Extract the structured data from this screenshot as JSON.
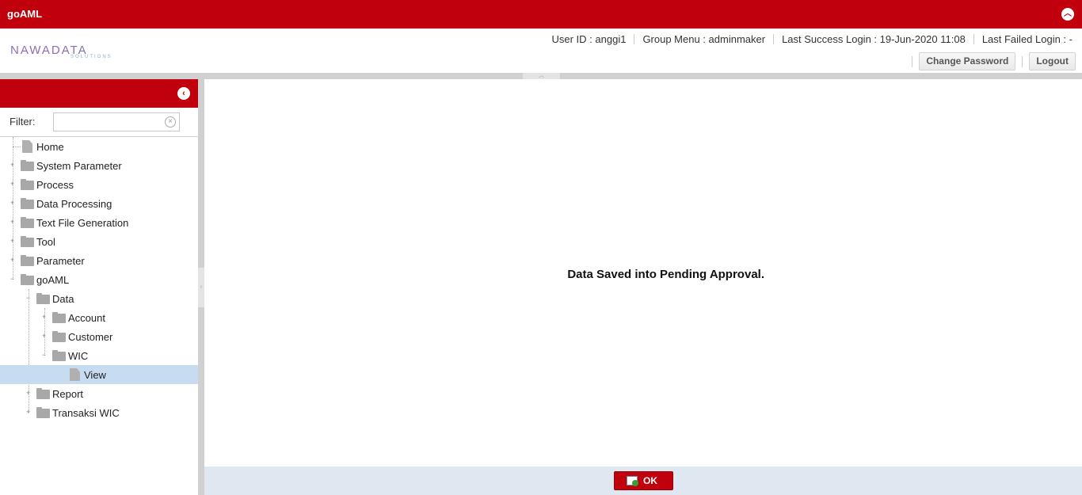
{
  "app": {
    "title": "goAML"
  },
  "header": {
    "logo_text": "NAWADATA",
    "logo_sub": "SOLUTIONS",
    "user_id": "User ID : anggi1",
    "group_menu": "Group Menu : adminmaker",
    "last_success_login": "Last Success Login : 19-Jun-2020 11:08",
    "last_failed_login": "Last Failed Login : -",
    "change_password_label": "Change Password",
    "logout_label": "Logout"
  },
  "sidebar": {
    "filter_label": "Filter:",
    "filter_value": "",
    "tree": [
      {
        "label": "Home",
        "type": "doc"
      },
      {
        "label": "System Parameter",
        "type": "folder"
      },
      {
        "label": "Process",
        "type": "folder"
      },
      {
        "label": "Data Processing",
        "type": "folder"
      },
      {
        "label": "Text File Generation",
        "type": "folder"
      },
      {
        "label": "Tool",
        "type": "folder"
      },
      {
        "label": "Parameter",
        "type": "folder"
      },
      {
        "label": "goAML",
        "type": "folder-open"
      },
      {
        "label": "Data",
        "type": "folder-open"
      },
      {
        "label": "Account",
        "type": "folder"
      },
      {
        "label": "Customer",
        "type": "folder"
      },
      {
        "label": "WIC",
        "type": "folder-open"
      },
      {
        "label": "View",
        "type": "doc",
        "selected": true
      },
      {
        "label": "Report",
        "type": "folder"
      },
      {
        "label": "Transaksi WIC",
        "type": "folder"
      }
    ]
  },
  "main": {
    "message": "Data Saved into Pending Approval."
  },
  "footer": {
    "ok_label": "OK"
  },
  "colors": {
    "brand_red": "#c0000c",
    "selection": "#c7dcf0",
    "footer_bg": "#dfe8f1"
  }
}
